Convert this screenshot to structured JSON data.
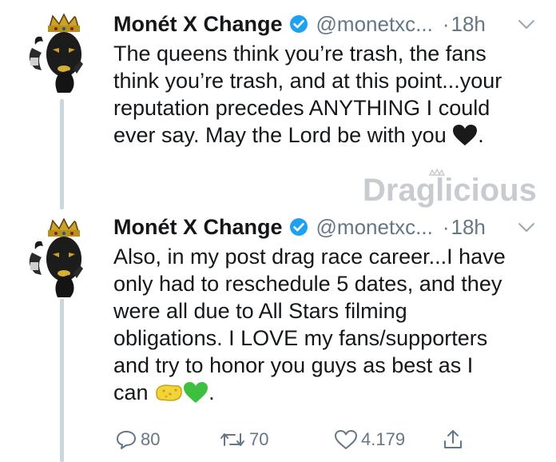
{
  "watermark": {
    "brand": "Draglicious"
  },
  "tweets": [
    {
      "author": {
        "display_name": "Monét X Change",
        "handle": "@monetxc...",
        "verified": true
      },
      "separator": "·",
      "time": "18h",
      "lines": [
        "The queens think you’re trash, the fans",
        "think you’re trash, and at this point...your",
        "reputation precedes ANYTHING I could",
        "ever say. May the Lord be with you"
      ],
      "line4_end": ".",
      "emoji": [
        "black-heart-icon"
      ]
    },
    {
      "author": {
        "display_name": "Monét X Change",
        "handle": "@monetxc...",
        "verified": true
      },
      "separator": "·",
      "time": "18h",
      "lines": [
        "Also, in my post drag race career...I have",
        "only had to reschedule 5 dates, and they",
        "were all due to All Stars filming",
        "obligations. I LOVE my fans/supporters",
        "and try to honor you guys as best as I",
        "can"
      ],
      "line6_end": ".",
      "emoji": [
        "sponge-icon",
        "green-heart-icon"
      ],
      "actions": {
        "replies": "80",
        "retweets": "70",
        "likes": "4.179"
      }
    }
  ],
  "colors": {
    "verified": "#1da1f2",
    "secondary_text": "#657786",
    "thread_line": "#ccd6dd"
  }
}
